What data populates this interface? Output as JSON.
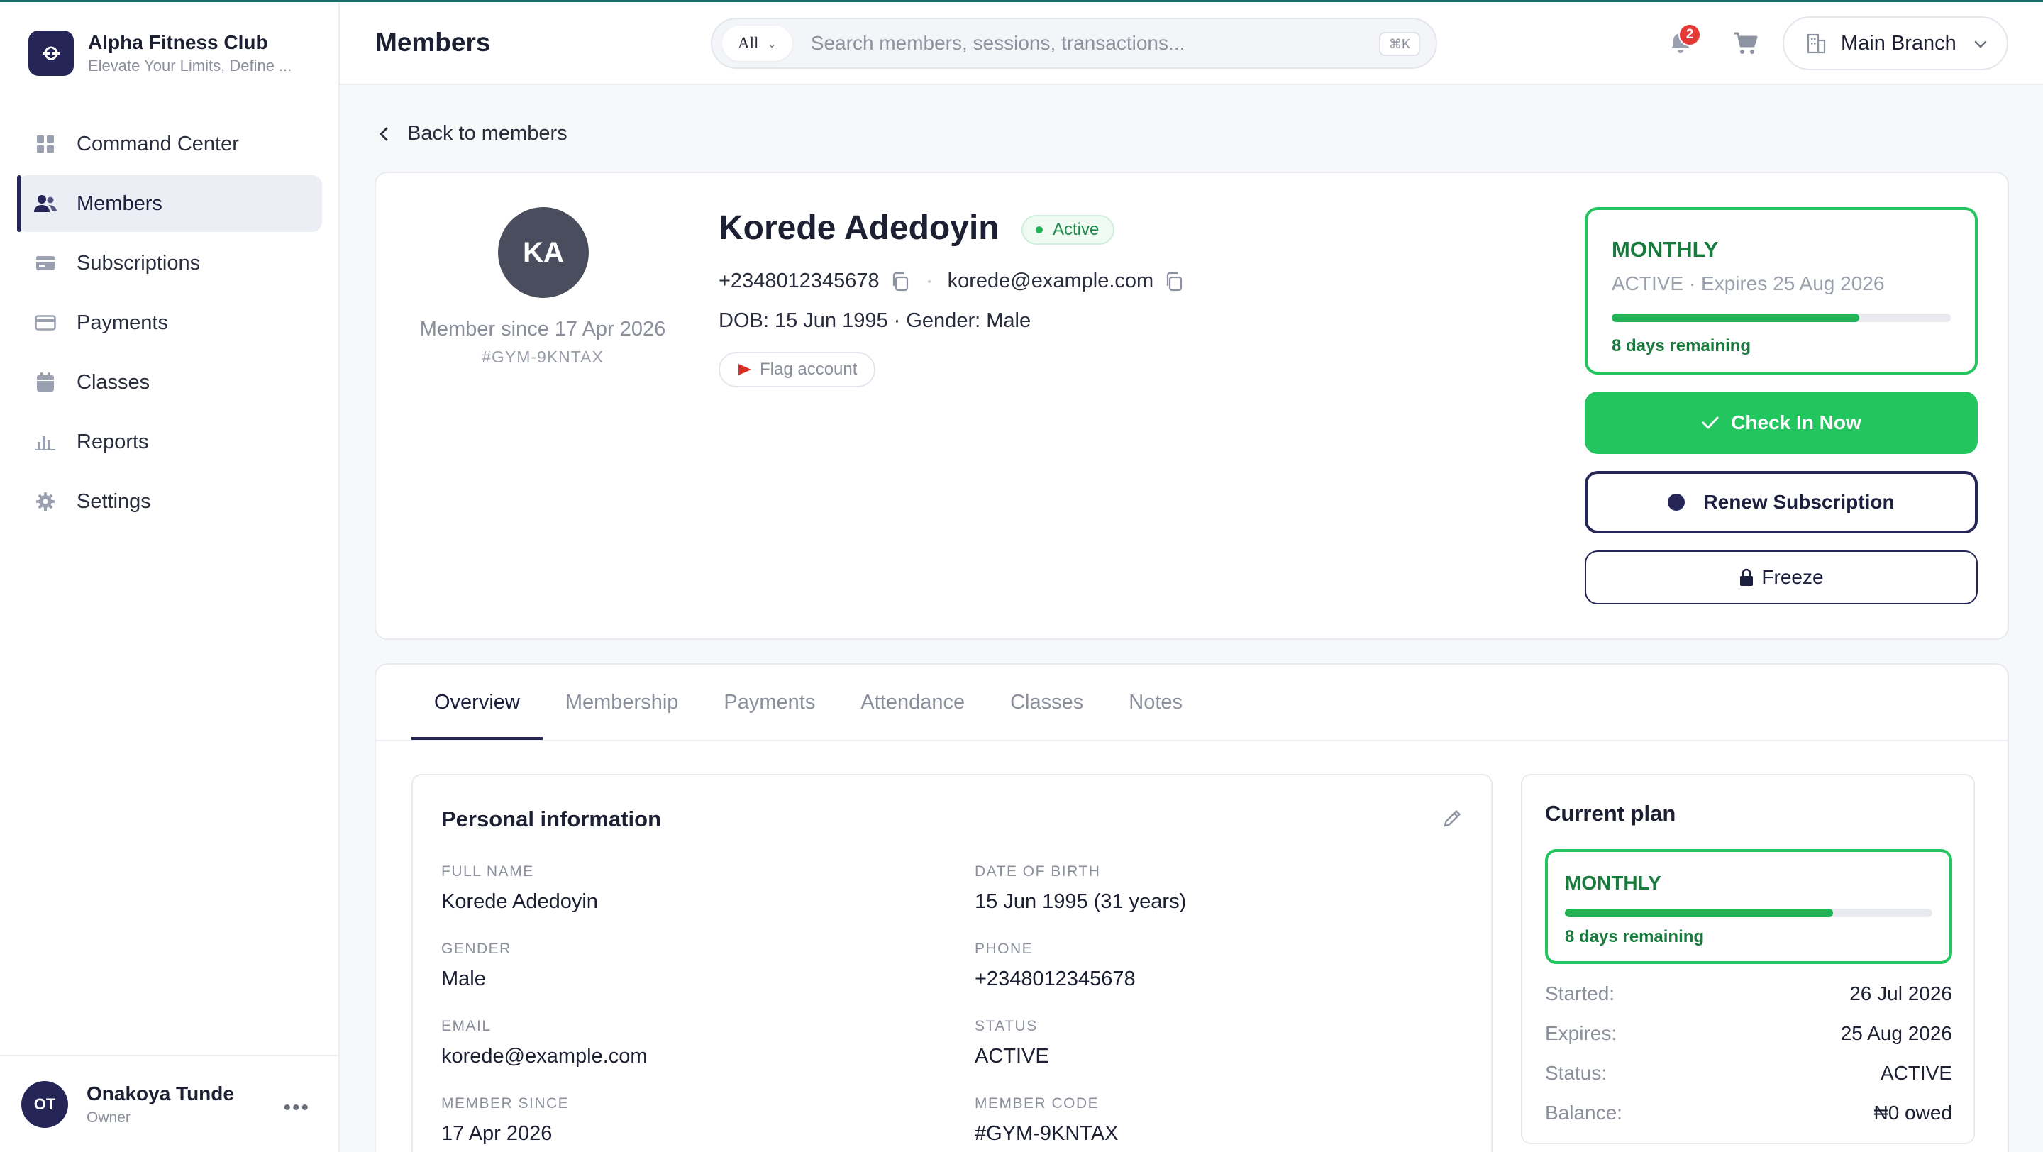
{
  "brand": {
    "name": "Alpha Fitness Club",
    "tagline": "Elevate Your Limits, Define ..."
  },
  "nav": [
    {
      "label": "Command Center",
      "icon": "grid-icon",
      "active": false
    },
    {
      "label": "Members",
      "icon": "users-icon",
      "active": true
    },
    {
      "label": "Subscriptions",
      "icon": "card-stack-icon",
      "active": false
    },
    {
      "label": "Payments",
      "icon": "credit-card-icon",
      "active": false
    },
    {
      "label": "Classes",
      "icon": "calendar-icon",
      "active": false
    },
    {
      "label": "Reports",
      "icon": "bar-chart-icon",
      "active": false
    },
    {
      "label": "Settings",
      "icon": "gear-icon",
      "active": false
    }
  ],
  "user": {
    "initials": "OT",
    "name": "Onakoya Tunde",
    "role": "Owner",
    "more": "•••"
  },
  "header": {
    "title": "Members",
    "search": {
      "scope": "All",
      "placeholder": "Search members, sessions, transactions...",
      "shortcut": "⌘K"
    },
    "notifications_count": "2",
    "branch": "Main Branch"
  },
  "back_label": "Back to members",
  "member": {
    "initials": "KA",
    "name": "Korede Adedoyin",
    "status": "Active",
    "phone": "+2348012345678",
    "email": "korede@example.com",
    "dob_gender": "DOB: 15 Jun 1995 · Gender: Male",
    "since": "Member since 17 Apr 2026",
    "code": "#GYM-9KNTAX",
    "flag_label": "Flag account"
  },
  "subscription": {
    "plan": "MONTHLY",
    "status_line": "ACTIVE · Expires 25 Aug 2026",
    "progress": 0.73,
    "remaining": "8 days remaining"
  },
  "actions": {
    "checkin": "Check In Now",
    "renew": "Renew Subscription",
    "freeze": "Freeze"
  },
  "tabs": [
    "Overview",
    "Membership",
    "Payments",
    "Attendance",
    "Classes",
    "Notes"
  ],
  "personal": {
    "title": "Personal information",
    "fields": [
      {
        "label": "FULL NAME",
        "value": "Korede Adedoyin"
      },
      {
        "label": "DATE OF BIRTH",
        "value": "15 Jun 1995 (31 years)"
      },
      {
        "label": "GENDER",
        "value": "Male"
      },
      {
        "label": "PHONE",
        "value": "+2348012345678"
      },
      {
        "label": "EMAIL",
        "value": "korede@example.com"
      },
      {
        "label": "STATUS",
        "value": "ACTIVE"
      },
      {
        "label": "MEMBER SINCE",
        "value": "17 Apr 2026"
      },
      {
        "label": "MEMBER CODE",
        "value": "#GYM-9KNTAX"
      }
    ]
  },
  "current_plan": {
    "title": "Current plan",
    "plan": "MONTHLY",
    "progress": 0.73,
    "remaining": "8 days remaining",
    "rows": [
      {
        "k": "Started:",
        "v": "26 Jul 2026"
      },
      {
        "k": "Expires:",
        "v": "25 Aug 2026"
      },
      {
        "k": "Status:",
        "v": "ACTIVE"
      },
      {
        "k": "Balance:",
        "v": "₦0 owed"
      }
    ]
  },
  "colors": {
    "primary": "#252657",
    "success": "#22c55e",
    "success_text": "#1a7a3e",
    "badge": "#e53935"
  }
}
